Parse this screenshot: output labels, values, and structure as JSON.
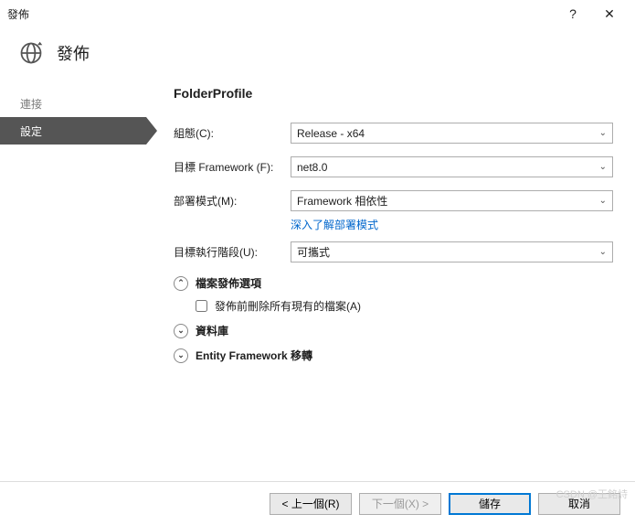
{
  "window": {
    "title": "發佈",
    "help": "?",
    "close": "✕"
  },
  "header": {
    "title": "發佈"
  },
  "sidebar": {
    "items": [
      {
        "label": "連接",
        "selected": false
      },
      {
        "label": "設定",
        "selected": true
      }
    ]
  },
  "profile": {
    "name": "FolderProfile"
  },
  "form": {
    "config": {
      "label": "組態(C):",
      "value": "Release - x64"
    },
    "framework": {
      "label": "目標 Framework (F):",
      "value": "net8.0"
    },
    "deployMode": {
      "label": "部署模式(M):",
      "value": "Framework 相依性",
      "learn": "深入了解部署模式"
    },
    "targetRuntime": {
      "label": "目標執行階段(U):",
      "value": "可攜式"
    }
  },
  "sections": {
    "filePublish": {
      "title": "檔案發佈選項",
      "expanded": true
    },
    "database": {
      "title": "資料庫",
      "expanded": false
    },
    "efMigrations": {
      "title": "Entity Framework 移轉",
      "expanded": false
    }
  },
  "options": {
    "deleteExisting": {
      "label": "發佈前刪除所有現有的檔案(A)",
      "checked": false
    }
  },
  "footer": {
    "prev": "< 上一個(R)",
    "next": "下一個(X) >",
    "save": "儲存",
    "cancel": "取消"
  },
  "watermark": "CSDN @王銘詩"
}
